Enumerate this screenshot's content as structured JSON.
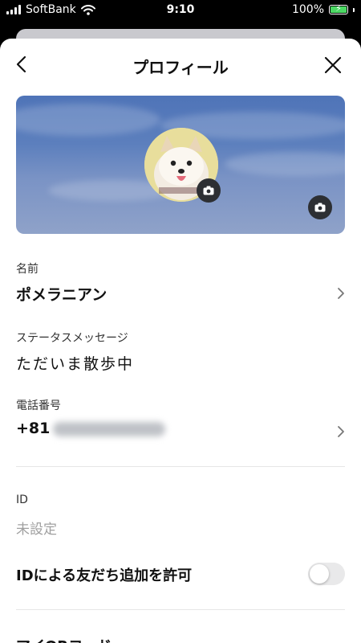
{
  "status_bar": {
    "carrier": "SoftBank",
    "time": "9:10",
    "battery": "100%"
  },
  "header": {
    "title": "プロフィール"
  },
  "profile": {
    "name_label": "名前",
    "name_value": "ポメラニアン",
    "status_label": "ステータスメッセージ",
    "status_value": "ただいま散歩中",
    "phone_label": "電話番号",
    "phone_prefix": "+81",
    "id_label": "ID",
    "id_value": "未設定",
    "allow_id_label": "IDによる友だち追加を許可",
    "allow_id_enabled": false,
    "qr_label": "マイQRコード"
  }
}
